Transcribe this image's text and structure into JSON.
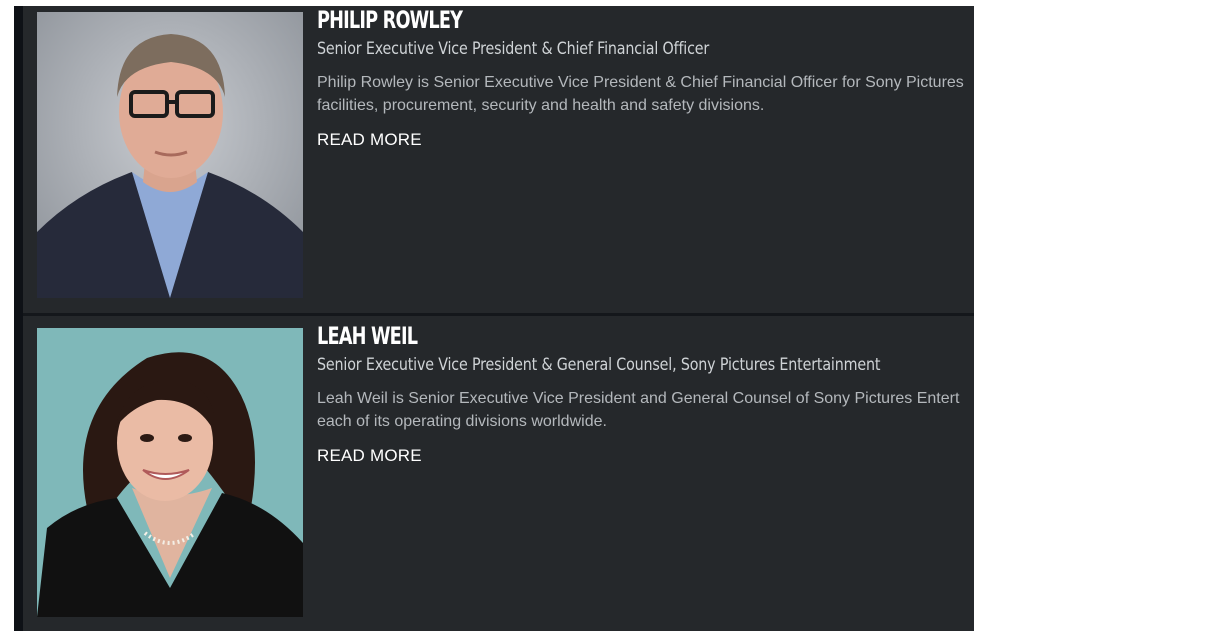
{
  "executives": [
    {
      "name": "PHILIP ROWLEY",
      "title": "Senior Executive Vice President & Chief Financial Officer",
      "bio_line1": "Philip Rowley is Senior Executive Vice President & Chief Financial Officer for Sony Pictures",
      "bio_line2": "facilities, procurement, security and health and safety divisions.",
      "read_more": "READ MORE"
    },
    {
      "name": "LEAH WEIL",
      "title": "Senior Executive Vice President & General Counsel, Sony Pictures Entertainment",
      "bio_line1": "Leah Weil is Senior Executive Vice President and General Counsel of Sony Pictures Entert",
      "bio_line2": "each of its operating divisions worldwide.",
      "read_more": "READ MORE"
    }
  ],
  "colors": {
    "panel_bg": "#25282b",
    "accent_edge": "#0e1116",
    "name_text": "#ffffff",
    "title_text": "#cfd3d6",
    "bio_text": "#b4b8bc"
  }
}
